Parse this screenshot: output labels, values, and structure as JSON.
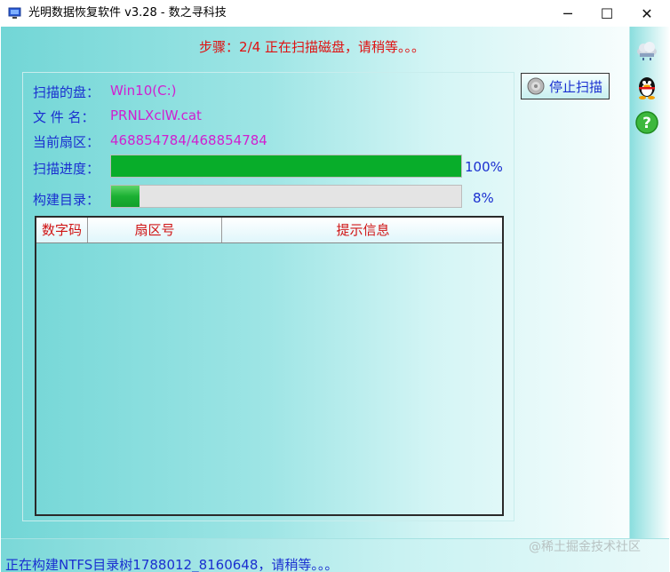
{
  "window": {
    "title": "光明数据恢复软件 v3.28 - 数之寻科技",
    "minimize_symbol": "─",
    "maximize_symbol": "☐",
    "close_symbol": "✕"
  },
  "step_text": "步骤：2/4 正在扫描磁盘，请稍等。。。",
  "scan": {
    "disk_label": "扫描的盘：",
    "disk_value": "Win10(C:)",
    "file_label": "文 件 名：",
    "file_value": "PRNLXclW.cat",
    "sector_label": "当前扇区：",
    "sector_value": "468854784/468854784",
    "progress_label": "扫描进度：",
    "progress_percent": 100,
    "progress_text": "100%",
    "build_label": "构建目录：",
    "build_percent": 8,
    "build_text": "8%"
  },
  "stop_button": {
    "label": "停止扫描",
    "icon": "disc-icon"
  },
  "table": {
    "columns": [
      "数字码",
      "扇区号",
      "提示信息"
    ],
    "rows": []
  },
  "side_icons": [
    "cloud-icon",
    "qq-penguin-icon",
    "help-icon"
  ],
  "status_text": "正在构建NTFS目录树1788012_8160648，请稍等。。。",
  "watermark": "@稀土掘金技术社区",
  "colors": {
    "label": "#1a2fd0",
    "value": "#d020d0",
    "step": "#e01010",
    "progress": "#08ad2a",
    "header_text": "#d01515"
  }
}
